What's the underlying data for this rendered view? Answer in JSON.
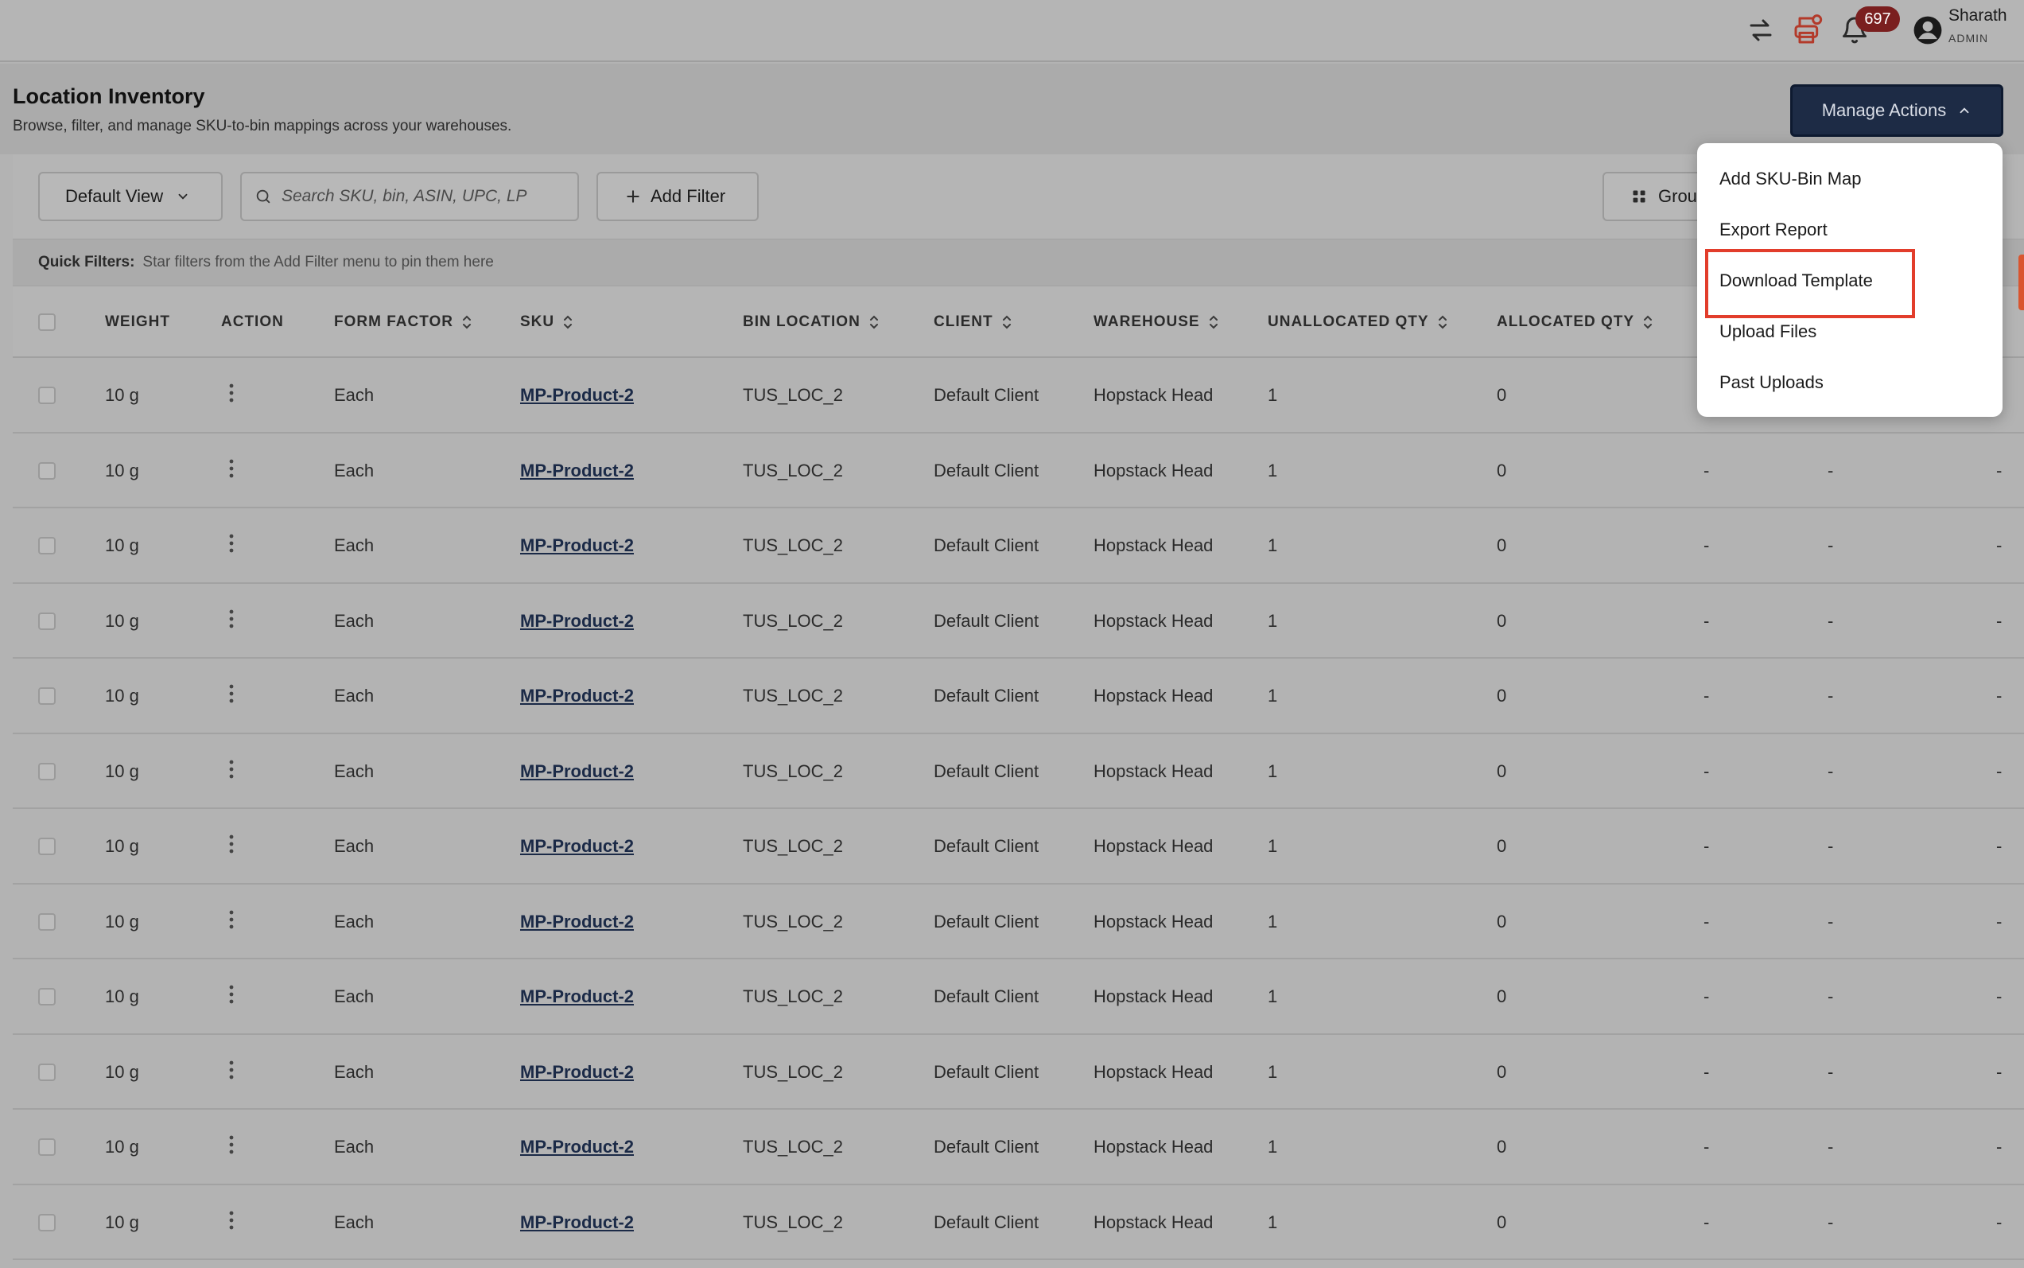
{
  "topbar": {
    "notification_count": "697",
    "user_name": "Sharath",
    "user_role": "ADMIN",
    "icons": [
      "swap-icon",
      "printer-alert-icon",
      "bell-icon",
      "user-avatar-icon"
    ]
  },
  "header": {
    "title": "Location Inventory",
    "subtitle": "Browse, filter, and manage SKU-to-bin mappings across your warehouses."
  },
  "manage_actions": {
    "label": "Manage Actions",
    "items": [
      "Add SKU-Bin Map",
      "Export Report",
      "Download Template",
      "Upload Files",
      "Past Uploads"
    ],
    "highlighted": "Download Template"
  },
  "toolbar": {
    "view_label": "Default View",
    "search_placeholder": "Search SKU, bin, ASIN, UPC, LP",
    "add_filter_label": "Add Filter",
    "group_label": "Grou"
  },
  "quick_filters": {
    "label": "Quick Filters:",
    "hint": "Star filters from the Add Filter menu to pin them here"
  },
  "columns": [
    "WEIGHT",
    "ACTION",
    "FORM FACTOR",
    "SKU",
    "BIN LOCATION",
    "CLIENT",
    "WAREHOUSE",
    "UNALLOCATED QTY",
    "ALLOCATED QTY"
  ],
  "rows": [
    {
      "weight": "10 g",
      "form_factor": "Each",
      "sku": "MP-Product-2",
      "bin": "TUS_LOC_2",
      "client": "Default Client",
      "warehouse": "Hopstack Head",
      "unallocated": "1",
      "allocated": "0",
      "c1": "",
      "c2": "",
      "c3": ""
    },
    {
      "weight": "10 g",
      "form_factor": "Each",
      "sku": "MP-Product-2",
      "bin": "TUS_LOC_2",
      "client": "Default Client",
      "warehouse": "Hopstack Head",
      "unallocated": "1",
      "allocated": "0",
      "c1": "-",
      "c2": "-",
      "c3": "-"
    },
    {
      "weight": "10 g",
      "form_factor": "Each",
      "sku": "MP-Product-2",
      "bin": "TUS_LOC_2",
      "client": "Default Client",
      "warehouse": "Hopstack Head",
      "unallocated": "1",
      "allocated": "0",
      "c1": "-",
      "c2": "-",
      "c3": "-"
    },
    {
      "weight": "10 g",
      "form_factor": "Each",
      "sku": "MP-Product-2",
      "bin": "TUS_LOC_2",
      "client": "Default Client",
      "warehouse": "Hopstack Head",
      "unallocated": "1",
      "allocated": "0",
      "c1": "-",
      "c2": "-",
      "c3": "-"
    },
    {
      "weight": "10 g",
      "form_factor": "Each",
      "sku": "MP-Product-2",
      "bin": "TUS_LOC_2",
      "client": "Default Client",
      "warehouse": "Hopstack Head",
      "unallocated": "1",
      "allocated": "0",
      "c1": "-",
      "c2": "-",
      "c3": "-"
    },
    {
      "weight": "10 g",
      "form_factor": "Each",
      "sku": "MP-Product-2",
      "bin": "TUS_LOC_2",
      "client": "Default Client",
      "warehouse": "Hopstack Head",
      "unallocated": "1",
      "allocated": "0",
      "c1": "-",
      "c2": "-",
      "c3": "-"
    },
    {
      "weight": "10 g",
      "form_factor": "Each",
      "sku": "MP-Product-2",
      "bin": "TUS_LOC_2",
      "client": "Default Client",
      "warehouse": "Hopstack Head",
      "unallocated": "1",
      "allocated": "0",
      "c1": "-",
      "c2": "-",
      "c3": "-"
    },
    {
      "weight": "10 g",
      "form_factor": "Each",
      "sku": "MP-Product-2",
      "bin": "TUS_LOC_2",
      "client": "Default Client",
      "warehouse": "Hopstack Head",
      "unallocated": "1",
      "allocated": "0",
      "c1": "-",
      "c2": "-",
      "c3": "-"
    },
    {
      "weight": "10 g",
      "form_factor": "Each",
      "sku": "MP-Product-2",
      "bin": "TUS_LOC_2",
      "client": "Default Client",
      "warehouse": "Hopstack Head",
      "unallocated": "1",
      "allocated": "0",
      "c1": "-",
      "c2": "-",
      "c3": "-"
    },
    {
      "weight": "10 g",
      "form_factor": "Each",
      "sku": "MP-Product-2",
      "bin": "TUS_LOC_2",
      "client": "Default Client",
      "warehouse": "Hopstack Head",
      "unallocated": "1",
      "allocated": "0",
      "c1": "-",
      "c2": "-",
      "c3": "-"
    },
    {
      "weight": "10 g",
      "form_factor": "Each",
      "sku": "MP-Product-2",
      "bin": "TUS_LOC_2",
      "client": "Default Client",
      "warehouse": "Hopstack Head",
      "unallocated": "1",
      "allocated": "0",
      "c1": "-",
      "c2": "-",
      "c3": "-"
    },
    {
      "weight": "10 g",
      "form_factor": "Each",
      "sku": "MP-Product-2",
      "bin": "TUS_LOC_2",
      "client": "Default Client",
      "warehouse": "Hopstack Head",
      "unallocated": "1",
      "allocated": "0",
      "c1": "-",
      "c2": "-",
      "c3": "-"
    }
  ],
  "colors": {
    "primary": "#1d2b45",
    "highlight": "#e23d2b",
    "badge": "#7a1f1f",
    "link": "#1b2a47"
  }
}
